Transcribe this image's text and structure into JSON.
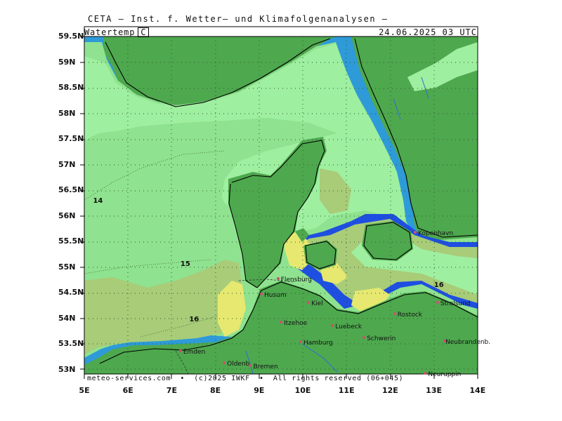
{
  "header": {
    "title": "CETA — Inst. f. Wetter— und Klimafolgenanalysen —",
    "variable": "Watertemp",
    "unit": "C",
    "datetime": "24.06.2025 03 UTC"
  },
  "footer": "meteo-services.com  •  (c)2025 IWKF  •  All rights reserved (06+045)",
  "axes": {
    "lat_labels": [
      "59.5N",
      "59N",
      "58.5N",
      "58N",
      "57.5N",
      "57N",
      "56.5N",
      "56N",
      "55.5N",
      "55N",
      "54.5N",
      "54N",
      "53.5N",
      "53N"
    ],
    "lon_labels": [
      "5E",
      "6E",
      "7E",
      "8E",
      "9E",
      "10E",
      "11E",
      "12E",
      "13E",
      "14E"
    ]
  },
  "isolines": [
    {
      "label": "14",
      "lon": 5.2,
      "lat": 56.28
    },
    {
      "label": "15",
      "lon": 7.2,
      "lat": 55.05
    },
    {
      "label": "16",
      "lon": 7.4,
      "lat": 53.98
    },
    {
      "label": "16",
      "lon": 13.0,
      "lat": 54.65
    }
  ],
  "cities": [
    {
      "name": "Flensburg",
      "lon": 9.43,
      "lat": 54.78
    },
    {
      "name": "Husum",
      "lon": 9.05,
      "lat": 54.48
    },
    {
      "name": "Kiel",
      "lon": 10.13,
      "lat": 54.32
    },
    {
      "name": "Itzehoe",
      "lon": 9.5,
      "lat": 53.93
    },
    {
      "name": "Luebeck",
      "lon": 10.68,
      "lat": 53.87
    },
    {
      "name": "Rostock",
      "lon": 12.1,
      "lat": 54.09
    },
    {
      "name": "Schwerin",
      "lon": 11.4,
      "lat": 53.63
    },
    {
      "name": "Hamburg",
      "lon": 9.95,
      "lat": 53.55
    },
    {
      "name": "Emden",
      "lon": 7.2,
      "lat": 53.37
    },
    {
      "name": "Oldenb.",
      "lon": 8.2,
      "lat": 53.14
    },
    {
      "name": "Bremen",
      "lon": 8.8,
      "lat": 53.08
    },
    {
      "name": "Neubrandenb.",
      "lon": 13.25,
      "lat": 53.56
    },
    {
      "name": "Neuruppin",
      "lon": 12.8,
      "lat": 52.93
    },
    {
      "name": "Kopenhavn",
      "lon": 12.57,
      "lat": 55.68
    },
    {
      "name": "Stralsund",
      "lon": 13.08,
      "lat": 54.31
    }
  ],
  "colors": {
    "land": "#4ea84e",
    "coast_dark": "#2f9a55",
    "coast_mid": "#4cbf7a",
    "coast_blue": "#1e4fe0",
    "coast_lightblue": "#2e9ad8",
    "sea_14": "#9fefa0",
    "sea_15": "#8fe28f",
    "sea_16": "#a8cc78",
    "sea_17": "#e6e870"
  }
}
